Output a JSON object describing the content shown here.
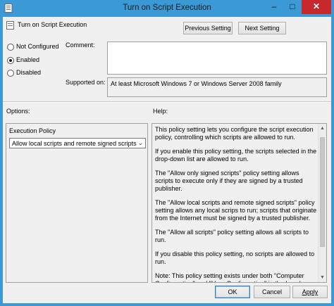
{
  "window": {
    "title": "Turn on Script Execution",
    "controls": {
      "minimize": "–",
      "maximize": "□",
      "close": "✕"
    }
  },
  "header": {
    "policy_name": "Turn on Script Execution",
    "previous_button_label": "Previous Setting",
    "next_button_label": "Next Setting"
  },
  "state": {
    "options": [
      {
        "label": "Not Configured",
        "selected": false
      },
      {
        "label": "Enabled",
        "selected": true
      },
      {
        "label": "Disabled",
        "selected": false
      }
    ]
  },
  "comment": {
    "label": "Comment:",
    "value": ""
  },
  "supported_on": {
    "label": "Supported on:",
    "value": "At least Microsoft Windows 7 or Windows Server 2008 family"
  },
  "options_pane": {
    "label": "Options:",
    "group_label": "Execution Policy",
    "selected_value": "Allow local scripts and remote signed scripts"
  },
  "help_pane": {
    "label": "Help:",
    "paragraphs": [
      "This policy setting lets you configure the script execution policy, controlling which scripts are allowed to run.",
      "If you enable this policy setting, the scripts selected in the drop-down list are allowed to run.",
      "The \"Allow only signed scripts\" policy setting allows scripts to execute only if they are signed by a trusted publisher.",
      "The \"Allow local scripts and remote signed scripts\" policy setting allows any local scrips to run; scripts that originate from the Internet must be signed by a trusted publisher.",
      "The \"Allow all scripts\" policy setting allows all scripts to run.",
      "If you disable this policy setting, no scripts are allowed to run.",
      "Note: This policy setting exists under both \"Computer Configuration\" and \"User Configuration\" in the Local Group Policy Editor. The \"Computer Configuration\" has precedence over \"User Configuration.\""
    ]
  },
  "footer": {
    "ok_label": "OK",
    "cancel_label": "Cancel",
    "apply_label": "Apply"
  },
  "colors": {
    "frame": "#3b9ad6",
    "close_button": "#c7282c",
    "dialog_background": "#f0f0f0"
  }
}
